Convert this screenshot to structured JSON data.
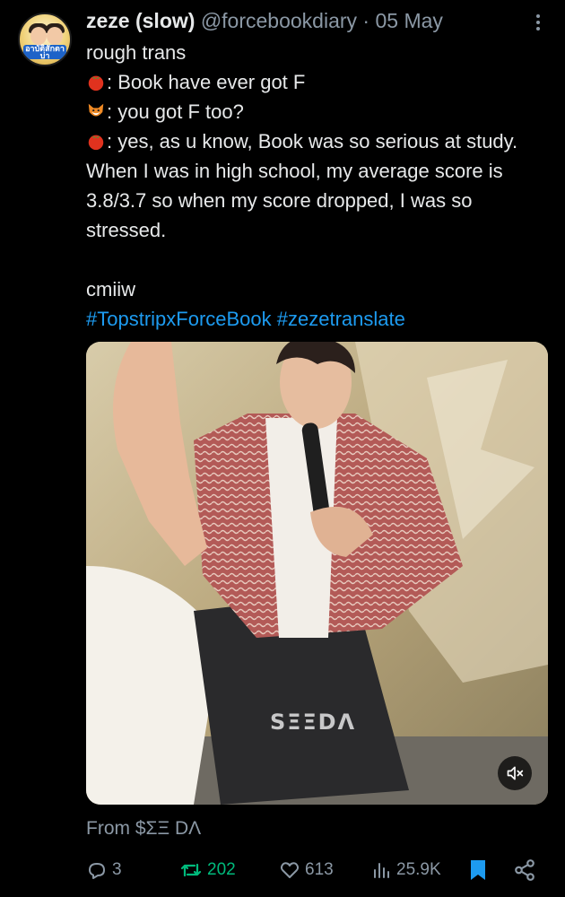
{
  "tweet": {
    "display_name": "zeze (slow)",
    "handle": "@forcebookdiary",
    "separator": "·",
    "date": "05 May",
    "avatar_text": "อาบัติสักตาบ่า",
    "lines": {
      "l1": "rough trans",
      "l2": ": Book have ever got F",
      "l3": ": you got F too?",
      "l4": ": yes, as u know, Book was so serious at study. When I was in high school, my average score is 3.8/3.7 so when my score dropped, I was so stressed.",
      "l5": "cmiiw"
    },
    "hashtags": "#TopstripxForceBook #zezetranslate",
    "media": {
      "watermark": "SΞΞDΛ",
      "mute_icon": "speaker-muted-icon"
    },
    "source": "From $ΣΞ DΛ"
  },
  "actions": {
    "reply_count": "3",
    "retweet_count": "202",
    "like_count": "613",
    "view_count": "25.9K"
  },
  "colors": {
    "background": "#000000",
    "text": "#e7e9ea",
    "secondary": "#8b98a5",
    "link": "#1d9bf0",
    "retweet_active": "#00ba7c",
    "bookmark_active": "#1d9bf0"
  },
  "icons": [
    "tomato-emoji-icon",
    "fox-emoji-icon",
    "more-icon",
    "reply-icon",
    "retweet-icon",
    "like-icon",
    "views-icon",
    "bookmark-icon",
    "share-icon"
  ]
}
